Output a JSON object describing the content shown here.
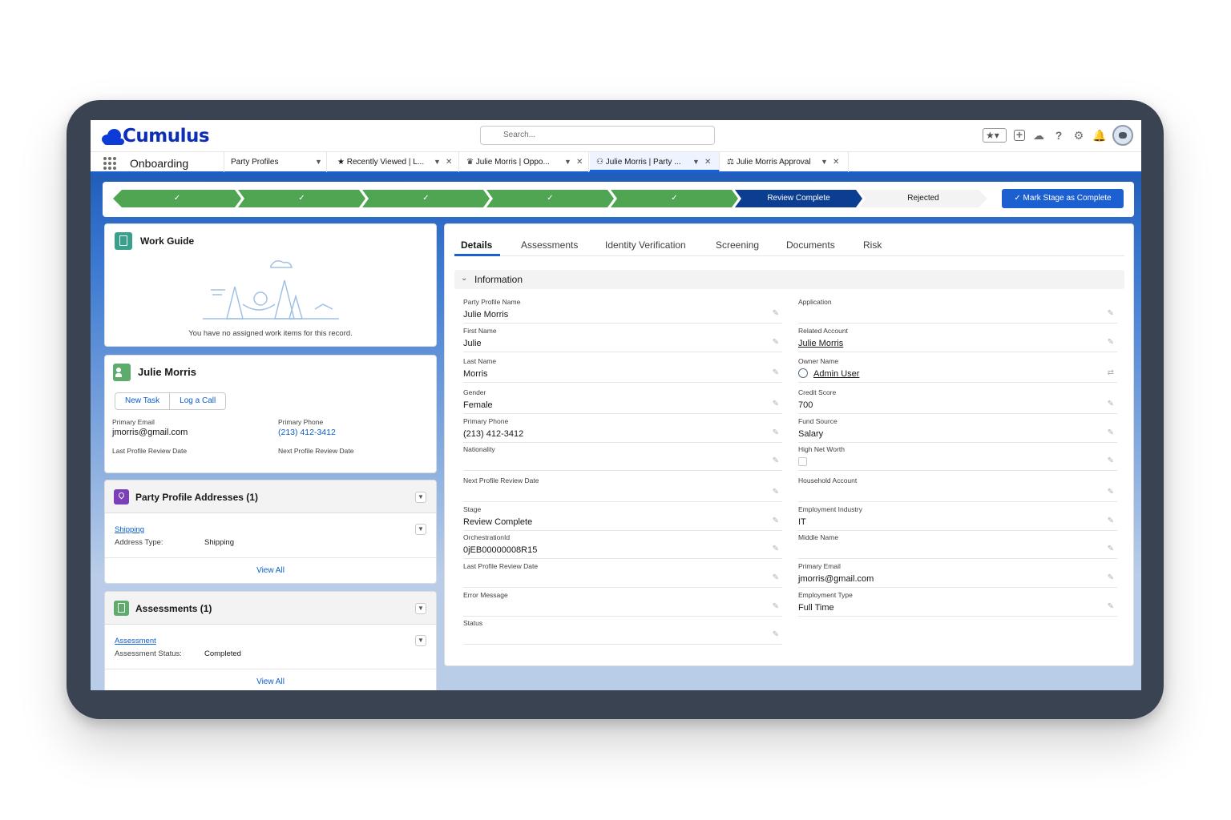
{
  "header": {
    "logo_text": "Cumulus",
    "search_placeholder": "Search..."
  },
  "tabbar": {
    "app_name": "Onboarding",
    "nav_item": "Party Profiles",
    "tabs": [
      {
        "label": "Recently Viewed | L...",
        "icon": "star-icon"
      },
      {
        "label": "Julie Morris | Oppo...",
        "icon": "crown-icon"
      },
      {
        "label": "Julie Morris | Party ...",
        "icon": "party-icon"
      },
      {
        "label": "Julie Morris Approval",
        "icon": "approval-icon"
      }
    ]
  },
  "path": {
    "stages": [
      "✓",
      "✓",
      "✓",
      "✓",
      "✓",
      "Review Complete",
      "Rejected"
    ],
    "mark_button": "Mark Stage as Complete"
  },
  "work_guide": {
    "title": "Work Guide",
    "empty_text": "You have no assigned work items for this record."
  },
  "profile": {
    "name": "Julie Morris",
    "new_task": "New Task",
    "log_call": "Log a Call",
    "primary_email_label": "Primary Email",
    "primary_email": "jmorris@gmail.com",
    "primary_phone_label": "Primary Phone",
    "primary_phone": "(213) 412-3412",
    "last_review_label": "Last Profile Review Date",
    "next_review_label": "Next Profile Review Date"
  },
  "addresses": {
    "title": "Party Profile Addresses (1)",
    "item_link": "Shipping",
    "type_label": "Address Type:",
    "type_value": "Shipping",
    "view_all": "View All"
  },
  "assessments": {
    "title": "Assessments (1)",
    "item_link": "Assessment",
    "status_label": "Assessment Status:",
    "status_value": "Completed",
    "view_all": "View All"
  },
  "detail": {
    "tabs": [
      "Details",
      "Assessments",
      "Identity Verification",
      "Screening",
      "Documents",
      "Risk"
    ],
    "section": "Information",
    "left_fields": [
      {
        "label": "Party Profile Name",
        "value": "Julie Morris"
      },
      {
        "label": "First Name",
        "value": "Julie"
      },
      {
        "label": "Last Name",
        "value": "Morris"
      },
      {
        "label": "Gender",
        "value": "Female"
      },
      {
        "label": "Primary Phone",
        "value": "(213) 412-3412"
      },
      {
        "label": "Nationality",
        "value": ""
      },
      {
        "label": "Next Profile Review Date",
        "value": ""
      },
      {
        "label": "Stage",
        "value": "Review Complete"
      },
      {
        "label": "OrchestrationId",
        "value": "0jEB00000008R15"
      },
      {
        "label": "Last Profile Review Date",
        "value": ""
      },
      {
        "label": "Error Message",
        "value": ""
      },
      {
        "label": "Status",
        "value": ""
      }
    ],
    "right_fields": [
      {
        "label": "Application",
        "value": ""
      },
      {
        "label": "Related Account",
        "value": "Julie Morris"
      },
      {
        "label": "Owner Name",
        "value": "Admin User"
      },
      {
        "label": "Credit Score",
        "value": "700"
      },
      {
        "label": "Fund Source",
        "value": "Salary"
      },
      {
        "label": "High Net Worth",
        "value": ""
      },
      {
        "label": "Household Account",
        "value": ""
      },
      {
        "label": "Employment Industry",
        "value": "IT"
      },
      {
        "label": "Middle Name",
        "value": ""
      },
      {
        "label": "Primary Email",
        "value": "jmorris@gmail.com"
      },
      {
        "label": "Employment Type",
        "value": "Full Time"
      }
    ]
  },
  "colors": {
    "brand": "#0d2fb8",
    "accent": "#1b5fd1",
    "stage_done": "#4fa552",
    "stage_current": "#0b3d91"
  }
}
